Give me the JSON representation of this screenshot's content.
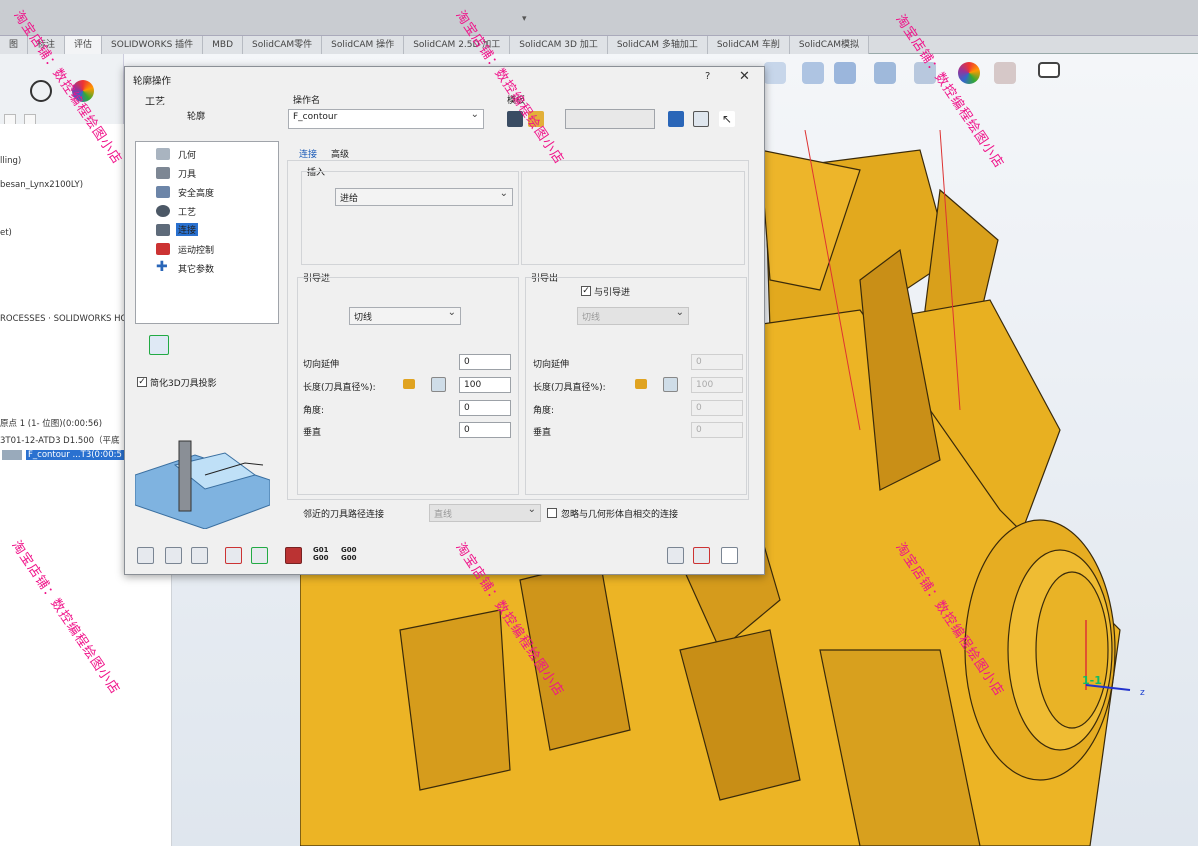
{
  "tabs": [
    "图",
    "标注",
    "评估",
    "SOLIDWORKS 插件",
    "MBD",
    "SolidCAM零件",
    "SolidCAM 操作",
    "SolidCAM 2.5D 加工",
    "SolidCAM 3D 加工",
    "SolidCAM 多轴加工",
    "SolidCAM 车削",
    "SolidCAM模拟"
  ],
  "tree": {
    "line1": "lling)",
    "line2": "besan_Lynx2100LY)",
    "line3": "et)",
    "line4": "ROCESSES · SOLIDWORKS HO",
    "line5": "原点 1 (1- 位图)(0:00:56)",
    "line6": "3T01-12-ATD3 D1.500（平底",
    "selected": "F_contour ...T3(0:00:5"
  },
  "dialog": {
    "title": "轮廓操作",
    "help": "?",
    "close": "✕",
    "tech_label": "工艺",
    "tech_value": "轮廓",
    "opname_label": "操作名",
    "opname_value": "F_contour",
    "template_label": "模板",
    "nav": [
      "几何",
      "刀具",
      "安全高度",
      "工艺",
      "连接",
      "运动控制",
      "其它参数"
    ],
    "nav_selected": 4,
    "simplify_label": "简化3D刀具投影",
    "subtabs": [
      "连接",
      "高级"
    ],
    "insert_label": "插入",
    "insert_value": "进给",
    "lead_in_label": "引导进",
    "lead_in_value": "切线",
    "lead_out_label": "引导出",
    "same_as_label": "与引导进",
    "lead_out_value": "切线",
    "left_fields": [
      {
        "label": "切向延伸",
        "value": "0"
      },
      {
        "label": "长度(刀具直径%):",
        "value": "100"
      },
      {
        "label": "角度:",
        "value": "0"
      },
      {
        "label": "垂直",
        "value": "0"
      }
    ],
    "right_fields": [
      {
        "label": "切向延伸",
        "value": "0"
      },
      {
        "label": "长度(刀具直径%):",
        "value": "100"
      },
      {
        "label": "角度:",
        "value": "0"
      },
      {
        "label": "垂直",
        "value": "0"
      }
    ],
    "nearby_label": "邻近的刀具路径连接",
    "nearby_value": "直线",
    "ignore_label": "忽略与几何形体自相交的连接",
    "bottom_g1": "G01\nG00",
    "bottom_g2": "G00\nG00"
  },
  "axis": {
    "label1": "1-1",
    "z": "z"
  },
  "watermark": "淘宝店铺：数控编程绘图小店",
  "colors": {
    "part": "#e8b021",
    "accent": "#2a71d0",
    "watermark": "#f0138a"
  }
}
